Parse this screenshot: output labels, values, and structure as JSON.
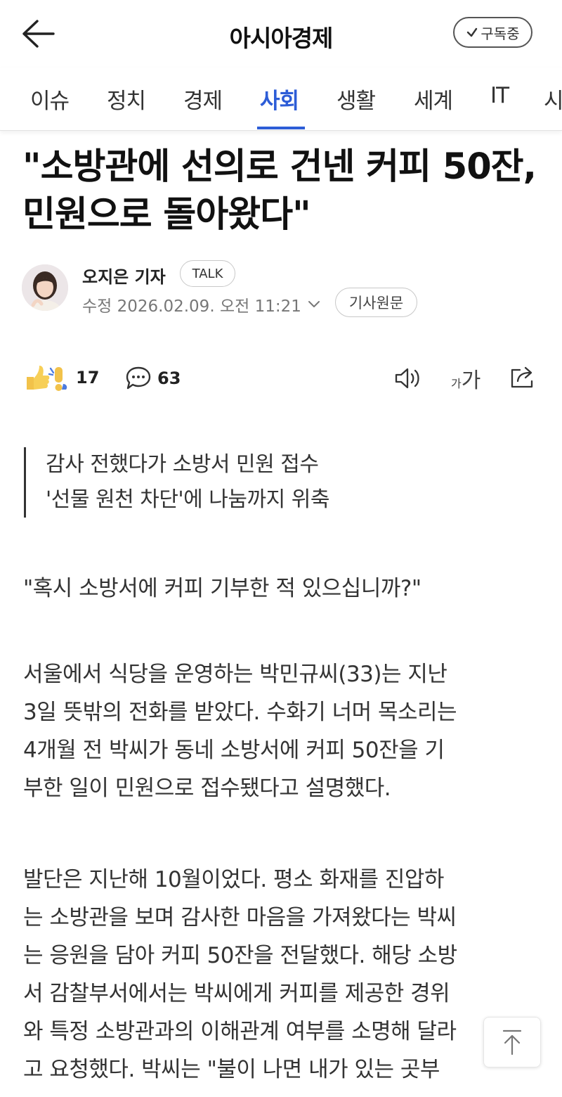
{
  "header": {
    "brand": "아시아경제",
    "subscribe_label": "구독중"
  },
  "tabs": [
    {
      "label": "이슈",
      "active": false
    },
    {
      "label": "정치",
      "active": false
    },
    {
      "label": "경제",
      "active": false
    },
    {
      "label": "사회",
      "active": true
    },
    {
      "label": "생활",
      "active": false
    },
    {
      "label": "세계",
      "active": false
    },
    {
      "label": "IT",
      "active": false
    },
    {
      "label": "시",
      "active": false
    }
  ],
  "article": {
    "headline": "\"소방관에 선의로 건넨 커피 50잔, 민원으로 돌아왔다\"",
    "author": "오지은 기자",
    "talk_label": "TALK",
    "date": "수정 2026.02.09. 오전 11:21",
    "original_label": "기사원문",
    "summary": [
      "감사 전했다가 소방서 민원 접수",
      "'선물 원천 차단'에 나눔까지 위축"
    ],
    "paragraphs": [
      [
        "\"혹시 소방서에 커피 기부한 적 있으십니까?\""
      ],
      [
        "서울에서 식당을 운영하는 박민규씨(33)는 지난",
        "3일 뜻밖의 전화를 받았다. 수화기 너머 목소리는",
        "4개월 전 박씨가 동네 소방서에 커피 50잔을 기",
        "부한 일이 민원으로 접수됐다고 설명했다."
      ],
      [
        "발단은 지난해 10월이었다. 평소 화재를 진압하",
        "는 소방관을 보며 감사한 마음을 가져왔다는 박씨",
        "는 응원을 담아 커피 50잔을 전달했다. 해당 소방",
        "서 감찰부서에서는 박씨에게 커피를 제공한 경위",
        "와 특정 소방관과의 이해관계 여부를 소명해 달라",
        "고 요청했다. 박씨는 \"불이 나면 내가 있는 곳부"
      ]
    ]
  },
  "actions": {
    "reaction_count": "17",
    "comment_count": "63",
    "font_small": "가",
    "font_large": "가"
  },
  "icons": [
    "back-arrow-icon",
    "check-icon",
    "reaction-icon",
    "comment-icon",
    "speaker-icon",
    "share-icon",
    "arrow-up-icon",
    "chevron-down-icon"
  ],
  "colors": {
    "accent": "#2d5dd7"
  }
}
